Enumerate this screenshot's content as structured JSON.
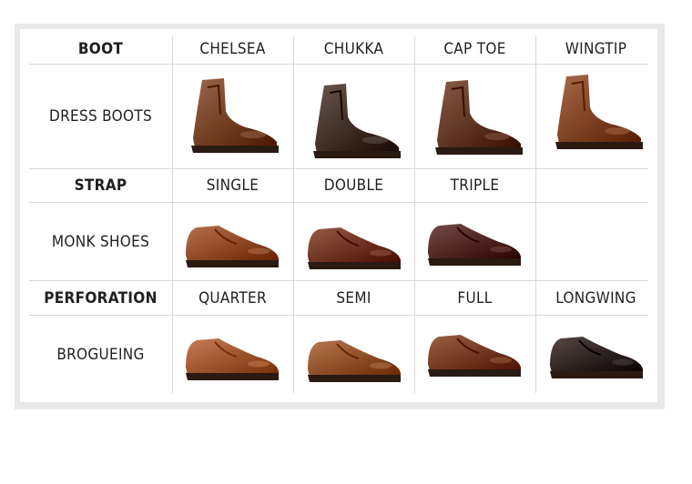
{
  "rows": [
    {
      "group": "BOOT",
      "styles": [
        "CHELSEA",
        "CHUKKA",
        "CAP TOE",
        "WINGTIP"
      ],
      "category": "DRESS BOOTS"
    },
    {
      "group": "STRAP",
      "styles": [
        "SINGLE",
        "DOUBLE",
        "TRIPLE",
        ""
      ],
      "category": "MONK SHOES"
    },
    {
      "group": "PERFORATION",
      "styles": [
        "QUARTER",
        "SEMI",
        "FULL",
        "LONGWING"
      ],
      "category": "BROGUEING"
    }
  ],
  "shoes": [
    {
      "name": "chelsea-boot",
      "kind": "boot",
      "color": "#6e3a1c"
    },
    {
      "name": "chukka-boot",
      "kind": "boot",
      "color": "#3b2a22"
    },
    {
      "name": "cap-toe-boot",
      "kind": "boot",
      "color": "#5a301a"
    },
    {
      "name": "wingtip-boot",
      "kind": "boot",
      "color": "#7a3e1c"
    },
    {
      "name": "single-monk-shoe",
      "kind": "shoe",
      "color": "#8a4420"
    },
    {
      "name": "double-monk-shoe",
      "kind": "shoe",
      "color": "#6a2e18"
    },
    {
      "name": "triple-monk-shoe",
      "kind": "shoe",
      "color": "#4a1f1a"
    },
    {
      "name": "quarter-brogue-shoe",
      "kind": "shoe",
      "color": "#9a5028"
    },
    {
      "name": "semi-brogue-shoe",
      "kind": "shoe",
      "color": "#8a4a22"
    },
    {
      "name": "full-brogue-shoe",
      "kind": "shoe",
      "color": "#6e3418"
    },
    {
      "name": "longwing-brogue-shoe",
      "kind": "shoe",
      "color": "#2a1c18"
    }
  ]
}
